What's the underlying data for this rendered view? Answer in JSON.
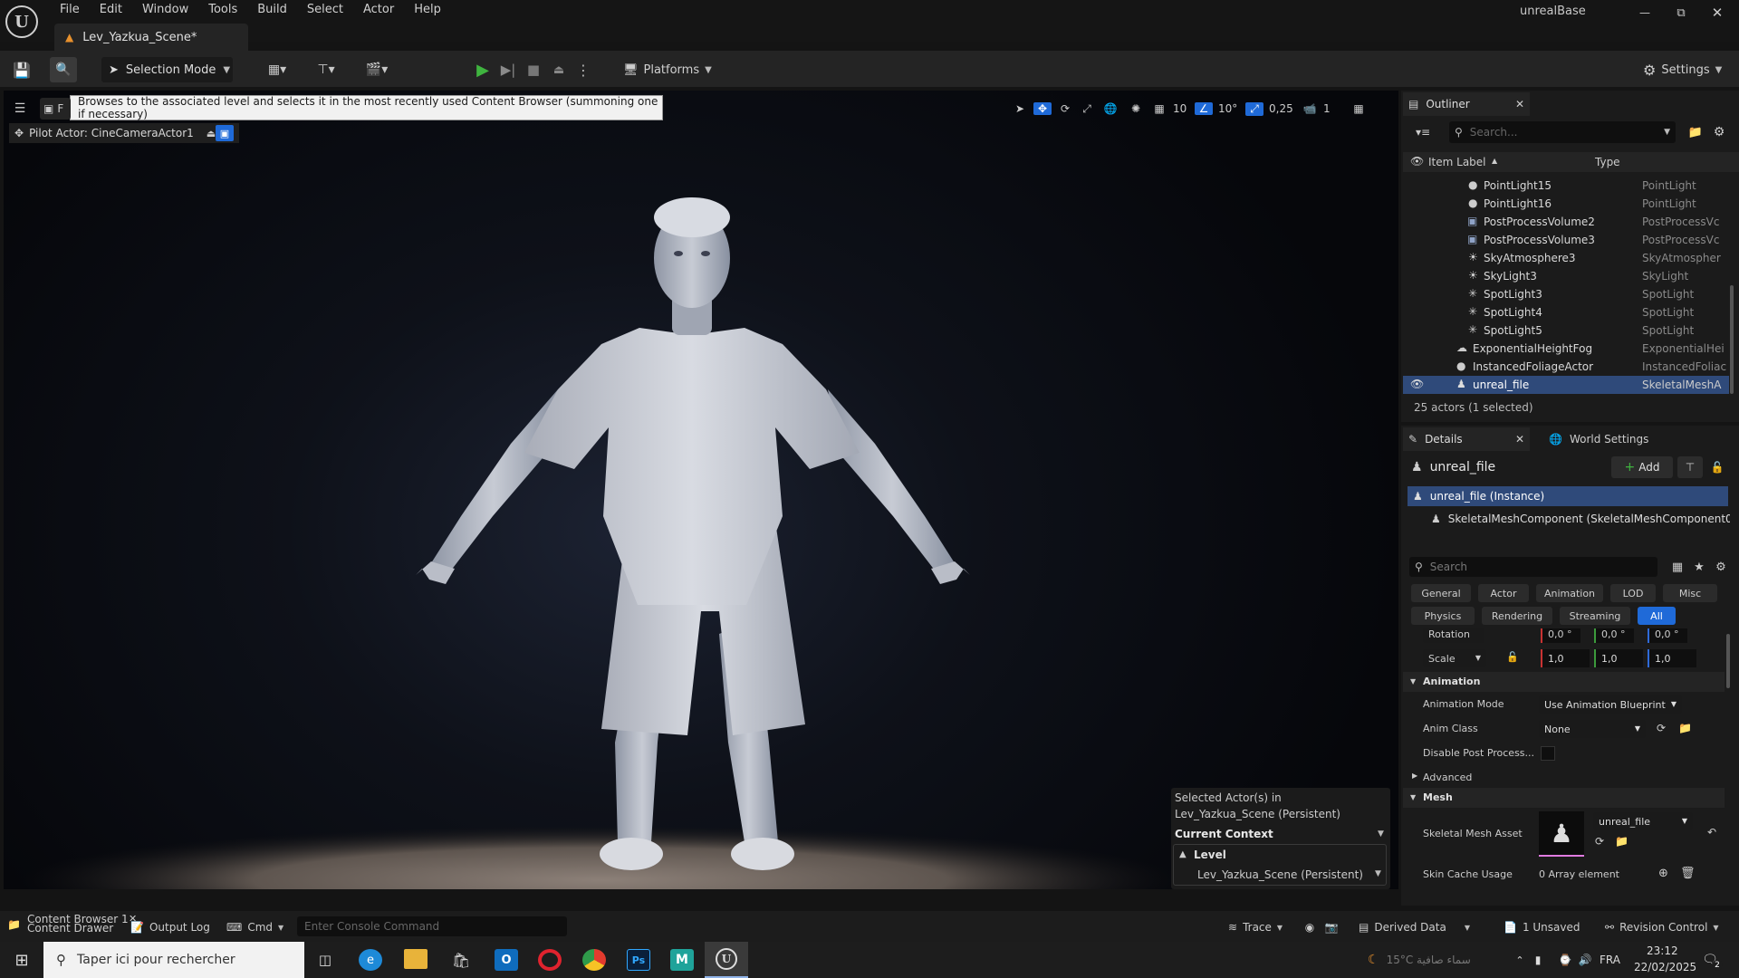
{
  "app": {
    "title": "unrealBase",
    "tab": "Lev_Yazkua_Scene*"
  },
  "menu": [
    "File",
    "Edit",
    "Window",
    "Tools",
    "Build",
    "Select",
    "Actor",
    "Help"
  ],
  "toolbar": {
    "selection_mode": "Selection Mode",
    "platforms": "Platforms",
    "settings": "Settings"
  },
  "tooltip": "Browses to the associated level and selects it in the most recently used Content Browser (summoning one if necessary)",
  "viewport": {
    "pilot": "Pilot Actor: CineCameraActor1",
    "grid": "10",
    "angle": "10°",
    "scale": "0,25",
    "camera_speed": "1",
    "tab_letter": "F"
  },
  "context": {
    "selected_line1": "Selected Actor(s) in",
    "selected_line2": "Lev_Yazkua_Scene (Persistent)",
    "current_context": "Current Context",
    "level": "Level",
    "level_value": "Lev_Yazkua_Scene (Persistent)"
  },
  "outliner": {
    "title": "Outliner",
    "search": "Search...",
    "col_label": "Item Label",
    "col_type": "Type",
    "status": "25 actors (1 selected)",
    "rows": [
      {
        "label": "PointLight15",
        "type": "PointLight"
      },
      {
        "label": "PointLight16",
        "type": "PointLight"
      },
      {
        "label": "PostProcessVolume2",
        "type": "PostProcessVc"
      },
      {
        "label": "PostProcessVolume3",
        "type": "PostProcessVc"
      },
      {
        "label": "SkyAtmosphere3",
        "type": "SkyAtmospher"
      },
      {
        "label": "SkyLight3",
        "type": "SkyLight"
      },
      {
        "label": "SpotLight3",
        "type": "SpotLight"
      },
      {
        "label": "SpotLight4",
        "type": "SpotLight"
      },
      {
        "label": "SpotLight5",
        "type": "SpotLight"
      },
      {
        "label": "ExponentialHeightFog",
        "type": "ExponentialHei"
      },
      {
        "label": "InstancedFoliageActor",
        "type": "InstancedFoliac"
      },
      {
        "label": "unreal_file",
        "type": "SkeletalMeshA"
      }
    ]
  },
  "details": {
    "tab": "Details",
    "world_tab": "World Settings",
    "actor": "unreal_file",
    "add": "Add",
    "instance": "unreal_file (Instance)",
    "component": "SkeletalMeshComponent (SkeletalMeshComponent0",
    "search": "Search",
    "filters": [
      "General",
      "Actor",
      "Animation",
      "LOD",
      "Misc",
      "Physics",
      "Rendering",
      "Streaming",
      "All"
    ],
    "rotation": "Rotation",
    "rot_vals": [
      "0,0 °",
      "0,0 °",
      "0,0 °"
    ],
    "scale": "Scale",
    "scale_vals": [
      "1,0",
      "1,0",
      "1,0"
    ],
    "animation": "Animation",
    "anim_mode": "Animation Mode",
    "anim_mode_val": "Use Animation Blueprint",
    "anim_class": "Anim Class",
    "anim_class_val": "None",
    "disable_pp": "Disable Post Process...",
    "advanced": "Advanced",
    "mesh": "Mesh",
    "skel_asset": "Skeletal Mesh Asset",
    "skel_asset_val": "unreal_file",
    "skin_cache": "Skin Cache Usage",
    "skin_cache_val": "0 Array element"
  },
  "bottom": {
    "content_browser": "Content Browser 1",
    "content_drawer": "Content Drawer",
    "output_log": "Output Log",
    "cmd": "Cmd",
    "console_placeholder": "Enter Console Command",
    "trace": "Trace",
    "derived": "Derived Data",
    "unsaved": "1 Unsaved",
    "revision": "Revision Control"
  },
  "taskbar": {
    "search": "Taper ici pour rechercher",
    "weather": "15°C  سماء صافية",
    "lang": "FRA",
    "time": "23:12",
    "date": "22/02/2025",
    "notif": "2"
  }
}
